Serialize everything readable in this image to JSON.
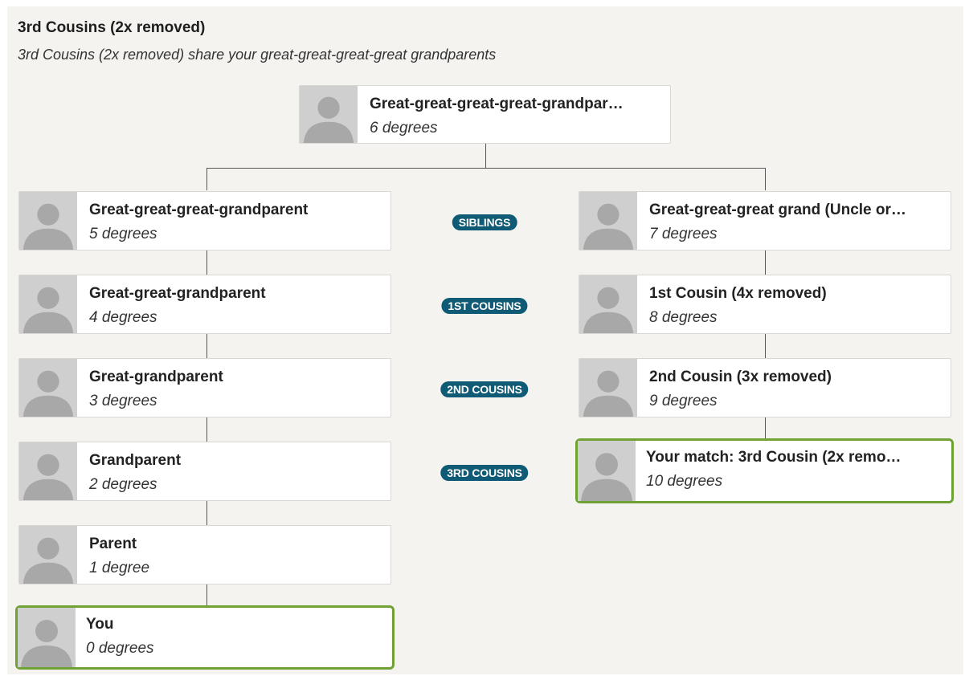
{
  "header": {
    "title": "3rd Cousins (2x removed)",
    "subtitle": "3rd Cousins (2x removed) share your great-great-great-great grandparents"
  },
  "top": {
    "name": "Great-great-great-great-grandpar…",
    "degrees": "6 degrees"
  },
  "left": [
    {
      "name": "Great-great-great-grandparent",
      "degrees": "5 degrees"
    },
    {
      "name": "Great-great-grandparent",
      "degrees": "4 degrees"
    },
    {
      "name": "Great-grandparent",
      "degrees": "3 degrees"
    },
    {
      "name": "Grandparent",
      "degrees": "2 degrees"
    },
    {
      "name": "Parent",
      "degrees": "1 degree"
    },
    {
      "name": "You",
      "degrees": "0 degrees"
    }
  ],
  "right": [
    {
      "name": "Great-great-great grand (Uncle or…",
      "degrees": "7 degrees"
    },
    {
      "name": "1st Cousin (4x removed)",
      "degrees": "8 degrees"
    },
    {
      "name": "2nd Cousin (3x removed)",
      "degrees": "9 degrees"
    },
    {
      "name": "Your match: 3rd Cousin (2x remo…",
      "degrees": "10 degrees"
    }
  ],
  "relations": [
    "SIBLINGS",
    "1ST COUSINS",
    "2ND COUSINS",
    "3RD COUSINS"
  ],
  "colors": {
    "match_border": "#6fa134",
    "pill": "#0f5a74",
    "background": "#f4f3f0"
  },
  "icons": {
    "avatar": "person-silhouette-icon"
  }
}
